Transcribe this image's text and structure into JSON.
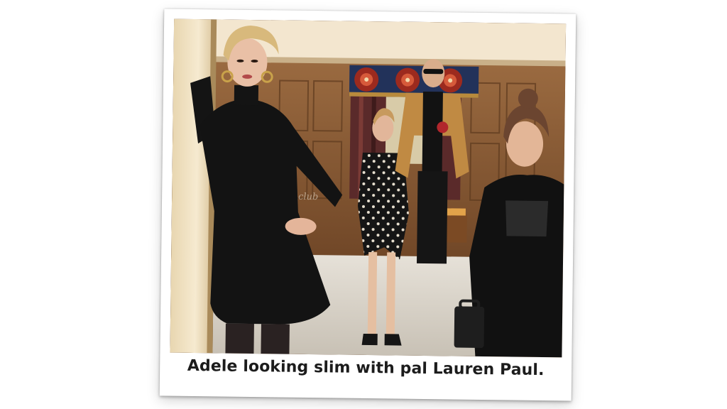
{
  "caption": "Adele looking slim with pal Lauren Paul.",
  "watermark": "club",
  "colors": {
    "wood_panel": "#8a5a34",
    "ceiling": "#f3e6cf",
    "floor": "#d9d4cb",
    "black_outfit": "#131313",
    "mustard_jacket": "#c08a43",
    "valance_red": "#9c2a1e",
    "valance_navy": "#22325a"
  }
}
